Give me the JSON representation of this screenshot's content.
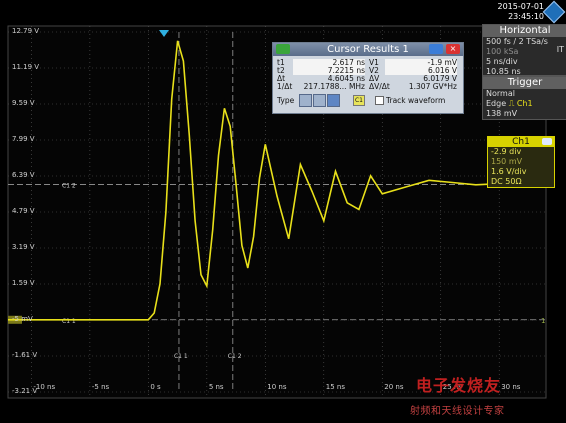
{
  "datetime": {
    "date": "2015-07-01",
    "time": "23:45:10"
  },
  "horizontal": {
    "title": "Horizontal",
    "line1": "500 fs / 2 TSa/s",
    "line2": "100 kSa",
    "line3": "5 ns/div",
    "line4": "10.85 ns",
    "marker": "IT"
  },
  "trigger": {
    "title": "Trigger",
    "mode": "Normal",
    "edge": "Edge",
    "source": "Ch1",
    "level": "138 mV"
  },
  "ch1": {
    "title": "Ch1",
    "offset": "-2.9 div",
    "pos": "150 mV",
    "scale": "1.6 V/div",
    "coupling": "DC 50Ω"
  },
  "cursor": {
    "title": "Cursor Results 1",
    "t1_label": "t1",
    "t1": "2.617 ns",
    "v1_label": "V1",
    "v1": "-1.9 mV",
    "t2_label": "t2",
    "t2": "7.2215 ns",
    "v2_label": "V2",
    "v2": "6.016 V",
    "dt_label": "Δt",
    "dt": "4.6045 ns",
    "dv_label": "ΔV",
    "dv": "6.0179 V",
    "inv_label": "1/Δt",
    "inv": "217.1788... MHz",
    "ratio_label": "ΔV/Δt",
    "ratio": "1.307 GV*Hz",
    "type_label": "Type",
    "source": "C1",
    "track": "Track waveform"
  },
  "y_labels": [
    "12.79 V",
    "11.19 V",
    "9.59 V",
    "7.99 V",
    "6.39 V",
    "4.79 V",
    "3.19 V",
    "1.59 V",
    "-5 mV",
    "-1.61 V",
    "-3.21 V"
  ],
  "x_labels": [
    "-10 ns",
    "-5 ns",
    "0 s",
    "5 ns",
    "10 ns",
    "15 ns",
    "20 ns",
    "25 ns",
    "30 ns"
  ],
  "cursor_labels": {
    "c1_h": "C1 2",
    "c1_l": "C1 1",
    "c1_v": "C1 1",
    "c2_v": "C1 2"
  },
  "ref_label": "1",
  "watermark": {
    "line1": "电子发烧友",
    "line2": "射频和天线设计专家"
  },
  "colors": {
    "trace": "#e8e01a",
    "grid": "#5a5a5a",
    "accent": "#d7d200"
  },
  "chart_data": {
    "type": "line",
    "xlabel": "",
    "ylabel": "",
    "xlim": [
      -12,
      34
    ],
    "ylim": [
      -3.21,
      12.79
    ],
    "series": [
      {
        "x": [
          -12,
          -1,
          0,
          0.5,
          1,
          1.5,
          2,
          2.5,
          3,
          3.5,
          4,
          4.5,
          5,
          5.5,
          6,
          6.5,
          7,
          7.5,
          8,
          8.5,
          9,
          9.5,
          10,
          11,
          12,
          13,
          14,
          15,
          16,
          17,
          18,
          19,
          20,
          22,
          24,
          26,
          28,
          30,
          32,
          34
        ],
        "y": [
          0,
          0,
          0,
          0.3,
          1.6,
          4.8,
          9.8,
          12.4,
          11.5,
          8.2,
          4.4,
          2.0,
          1.5,
          4.0,
          7.3,
          9.4,
          8.6,
          6.0,
          3.3,
          2.3,
          3.7,
          6.3,
          7.8,
          5.5,
          3.6,
          6.9,
          5.7,
          4.4,
          6.6,
          5.2,
          4.9,
          6.4,
          5.6,
          5.9,
          6.2,
          6.1,
          6.0,
          6.05,
          6.0,
          6.0
        ]
      }
    ]
  }
}
